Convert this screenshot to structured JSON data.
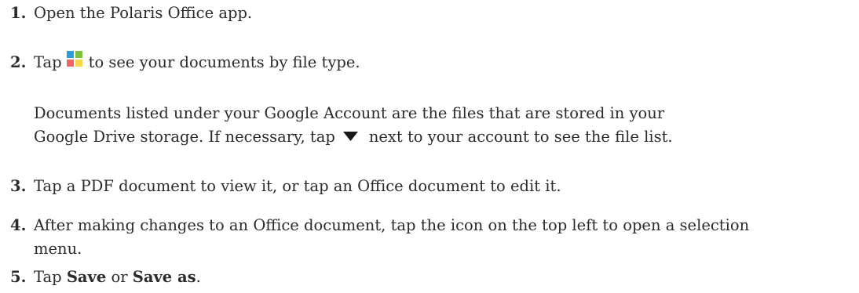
{
  "steps": [
    {
      "num": "1.",
      "text": "Open the Polaris Office app."
    },
    {
      "num": "2.",
      "before": "Tap",
      "icon": "filetype-grid-icon",
      "after": "to see your documents by file type."
    },
    {
      "num": "3.",
      "text": "Tap a PDF document to view it, or tap an Office document to edit it."
    },
    {
      "num": "4.",
      "line1": "After making changes to an Office document, tap the icon on the top left to open a selection",
      "line2": "menu."
    },
    {
      "num": "5.",
      "before": "Tap",
      "bold1": "Save",
      "mid": "or",
      "bold2": "Save as",
      "end": "."
    }
  ],
  "note": {
    "line1": "Documents listed under your Google Account are the files that are stored in your",
    "line2_before": "Google Drive storage. If necessary, tap",
    "icon": "dropdown-triangle-icon",
    "line2_after": "next to your account to see the file list."
  },
  "colors": {
    "icon_blue": "#2c9be0",
    "icon_green": "#7ac143",
    "icon_red": "#f06466",
    "icon_yellow": "#f7d54a",
    "triangle": "#1a1a1a"
  }
}
